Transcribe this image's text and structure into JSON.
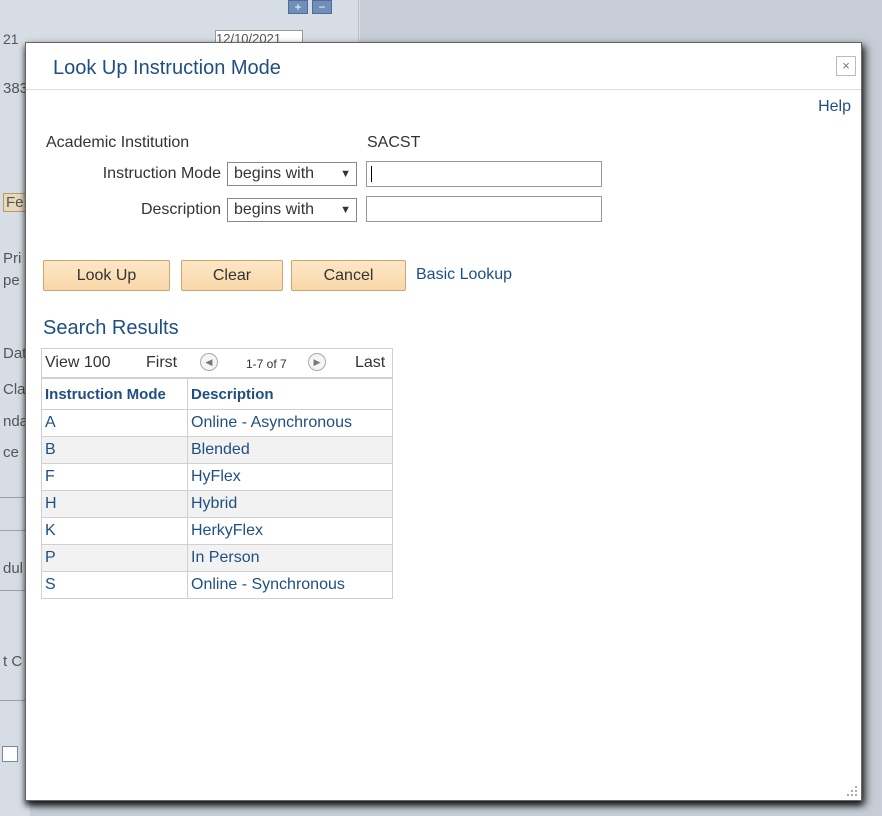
{
  "background": {
    "fragments": {
      "date_start_suffix": "21",
      "date_end": "12/10/2021",
      "f1": "383",
      "f2": "Fe",
      "f3": "Pri",
      "f4": "pe",
      "f5": "Dat",
      "f6": "Cla",
      "f7": "nda",
      "f8": "ce",
      "f9": "dul",
      "f10": "t C"
    },
    "plus_label": "+",
    "minus_label": "−"
  },
  "modal": {
    "title": "Look Up Instruction Mode",
    "close_icon": "×",
    "help_label": "Help"
  },
  "criteria": {
    "institution_label": "Academic Institution",
    "institution_value": "SACST",
    "instruction_mode_label": "Instruction Mode",
    "instruction_mode_operator": "begins with",
    "instruction_mode_value": "",
    "description_label": "Description",
    "description_operator": "begins with",
    "description_value": ""
  },
  "buttons": {
    "look_up": "Look Up",
    "clear": "Clear",
    "cancel": "Cancel",
    "basic_lookup": "Basic Lookup"
  },
  "results": {
    "title": "Search Results",
    "nav": {
      "view_label": "View 100",
      "first_label": "First",
      "range": "1-7 of 7",
      "last_label": "Last"
    },
    "columns": [
      "Instruction Mode",
      "Description"
    ],
    "rows": [
      {
        "mode": "A",
        "description": "Online - Asynchronous"
      },
      {
        "mode": "B",
        "description": "Blended"
      },
      {
        "mode": "F",
        "description": "HyFlex"
      },
      {
        "mode": "H",
        "description": "Hybrid"
      },
      {
        "mode": "K",
        "description": "HerkyFlex"
      },
      {
        "mode": "P",
        "description": "In Person"
      },
      {
        "mode": "S",
        "description": "Online - Synchronous"
      }
    ]
  },
  "colors": {
    "link": "#1f4f82",
    "button_bg": "#f8d7a8",
    "overlay": "#c6cdd6"
  }
}
